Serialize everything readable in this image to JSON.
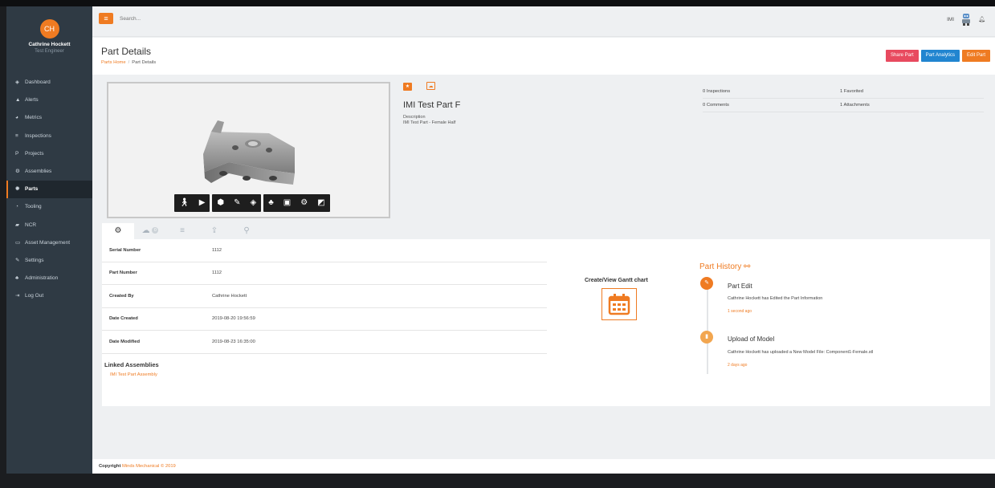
{
  "sidebar": {
    "avatar_initials": "CH",
    "user_name": "Cathrine Hockett",
    "user_role": "Test Engineer",
    "items": [
      {
        "label": "Dashboard",
        "icon": "dashboard-icon",
        "glyph": "◈"
      },
      {
        "label": "Alerts",
        "icon": "bell-icon",
        "glyph": "▲"
      },
      {
        "label": "Metrics",
        "icon": "metrics-icon",
        "glyph": "◕"
      },
      {
        "label": "Inspections",
        "icon": "list-icon",
        "glyph": "≡"
      },
      {
        "label": "Projects",
        "icon": "projects-icon",
        "glyph": "P"
      },
      {
        "label": "Assemblies",
        "icon": "gears-icon",
        "glyph": "⚙"
      },
      {
        "label": "Parts",
        "icon": "gear-icon",
        "glyph": "✹"
      },
      {
        "label": "Tooling",
        "icon": "tooling-icon",
        "glyph": "◔"
      },
      {
        "label": "NCR",
        "icon": "ncr-icon",
        "glyph": "▰"
      },
      {
        "label": "Asset Management",
        "icon": "laptop-icon",
        "glyph": "▭"
      },
      {
        "label": "Settings",
        "icon": "wrench-icon",
        "glyph": "✎"
      },
      {
        "label": "Administration",
        "icon": "sitemap-icon",
        "glyph": "♣"
      },
      {
        "label": "Log Out",
        "icon": "sign-out-icon",
        "glyph": "⇥"
      }
    ],
    "active_index": 6
  },
  "header": {
    "search_placeholder": "Search...",
    "brand_text": "IMI"
  },
  "page": {
    "title": "Part Details",
    "breadcrumb_home": "Parts Home",
    "breadcrumb_sep": "/",
    "breadcrumb_current": "Part Details",
    "buttons": {
      "share": "Share Part",
      "analytics": "Part Analytics",
      "edit": "Edit Part"
    }
  },
  "part": {
    "name": "IMI Test Part F",
    "description_label": "Description",
    "description": "IMI Test Part - Female Half"
  },
  "stats": {
    "inspections": "0 Inspections",
    "favorited": "1 Favorited",
    "comments": "0 Comments",
    "attachments": "1 Attachments"
  },
  "tabs": {
    "comments_count": "0"
  },
  "details": [
    {
      "label": "Serial Number",
      "value": "1112"
    },
    {
      "label": "Part Number",
      "value": "1112"
    },
    {
      "label": "Created By",
      "value": "Cathrine Hockett"
    },
    {
      "label": "Date Created",
      "value": "2019-08-20 19:56:59"
    },
    {
      "label": "Date Modified",
      "value": "2019-08-23 16:35:00"
    }
  ],
  "linked": {
    "heading": "Linked Assemblies",
    "item": "IMI Test Part Assembly"
  },
  "gantt": {
    "title": "Create/View Gantt chart"
  },
  "history": {
    "title": "Part History",
    "events": [
      {
        "title": "Part Edit",
        "desc": "Cathrine Hockett has Edited the Part Information",
        "time": "1 second ago"
      },
      {
        "title": "Upload of Model",
        "desc": "Cathrine Hockett has uploaded a New Model File: Component1-Female.stl",
        "time": "2 days ago"
      }
    ]
  },
  "footer": {
    "label": "Copyright",
    "brand": "Minds Mechanical © 2019"
  },
  "colors": {
    "accent": "#ef7b22",
    "sidebar": "#2f3a44",
    "share": "#e84a5f",
    "analytics": "#2185d0"
  }
}
